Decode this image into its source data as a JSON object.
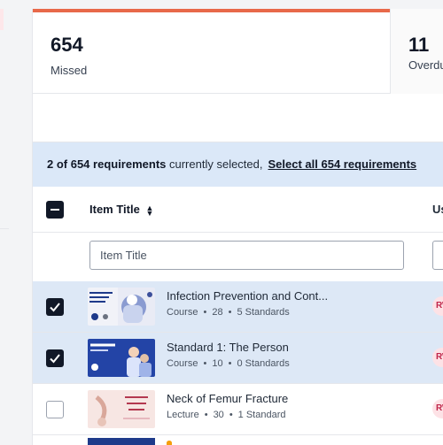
{
  "stats": [
    {
      "value": "654",
      "label": "Missed"
    },
    {
      "value": "11",
      "label": "Overdue"
    }
  ],
  "selection": {
    "count_text": "2 of 654 requirements",
    "suffix": " currently selected,",
    "select_all": "Select all 654 requirements"
  },
  "table": {
    "col_title": "Item Title",
    "col_user": "Us",
    "filter_placeholder": "Item Title",
    "rows": [
      {
        "title": "Infection Prevention and Cont...",
        "type": "Course",
        "count": "28",
        "standards": "5 Standards",
        "selected": true,
        "badge": "RW"
      },
      {
        "title": "Standard 1: The Person",
        "type": "Course",
        "count": "10",
        "standards": "0 Standards",
        "selected": true,
        "badge": "RW"
      },
      {
        "title": "Neck of Femur Fracture",
        "type": "Lecture",
        "count": "30",
        "standards": "1 Standard",
        "selected": false,
        "badge": "RW"
      }
    ]
  },
  "icons": {
    "sort": "sort-icon",
    "check": "check-icon",
    "indeterminate": "minus-icon"
  },
  "colors": {
    "accent": "#e8694a",
    "selected_row": "#dde8f6",
    "selection_bar": "#dbe8f8",
    "badge_bg": "#fde2e6",
    "badge_text": "#c0264a"
  }
}
